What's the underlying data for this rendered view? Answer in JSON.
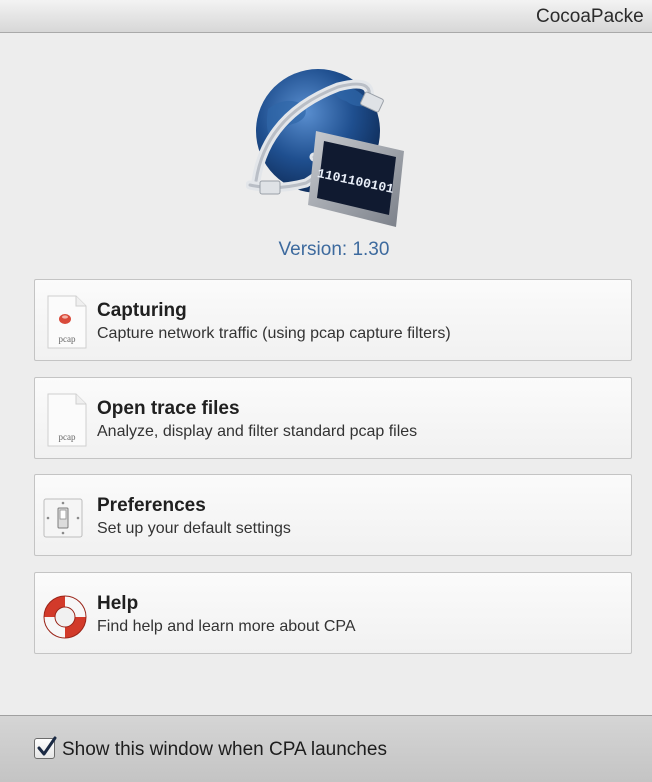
{
  "window": {
    "title": "CocoaPacke"
  },
  "logo": {
    "icon": "globe-monitor-network-icon",
    "screen_text": "1101100101"
  },
  "version_text": "Version: 1.30",
  "menu": [
    {
      "title": "Capturing",
      "description": "Capture network traffic (using pcap capture filters)",
      "icon": "pcap-capture-document-icon",
      "icon_text": "pcap"
    },
    {
      "title": "Open trace files",
      "description": "Analyze, display and filter standard pcap files",
      "icon": "pcap-document-icon",
      "icon_text": "pcap"
    },
    {
      "title": "Preferences",
      "description": "Set up your default settings",
      "icon": "light-switch-icon"
    },
    {
      "title": "Help",
      "description": "Find help and learn more about CPA",
      "icon": "lifebuoy-icon"
    }
  ],
  "footer": {
    "checkbox_label": "Show this window when CPA launches",
    "checked": true
  },
  "colors": {
    "version_text": "#3d6a9e",
    "globe": "#1f4f8f",
    "lifebuoy": "#d23a2a"
  }
}
